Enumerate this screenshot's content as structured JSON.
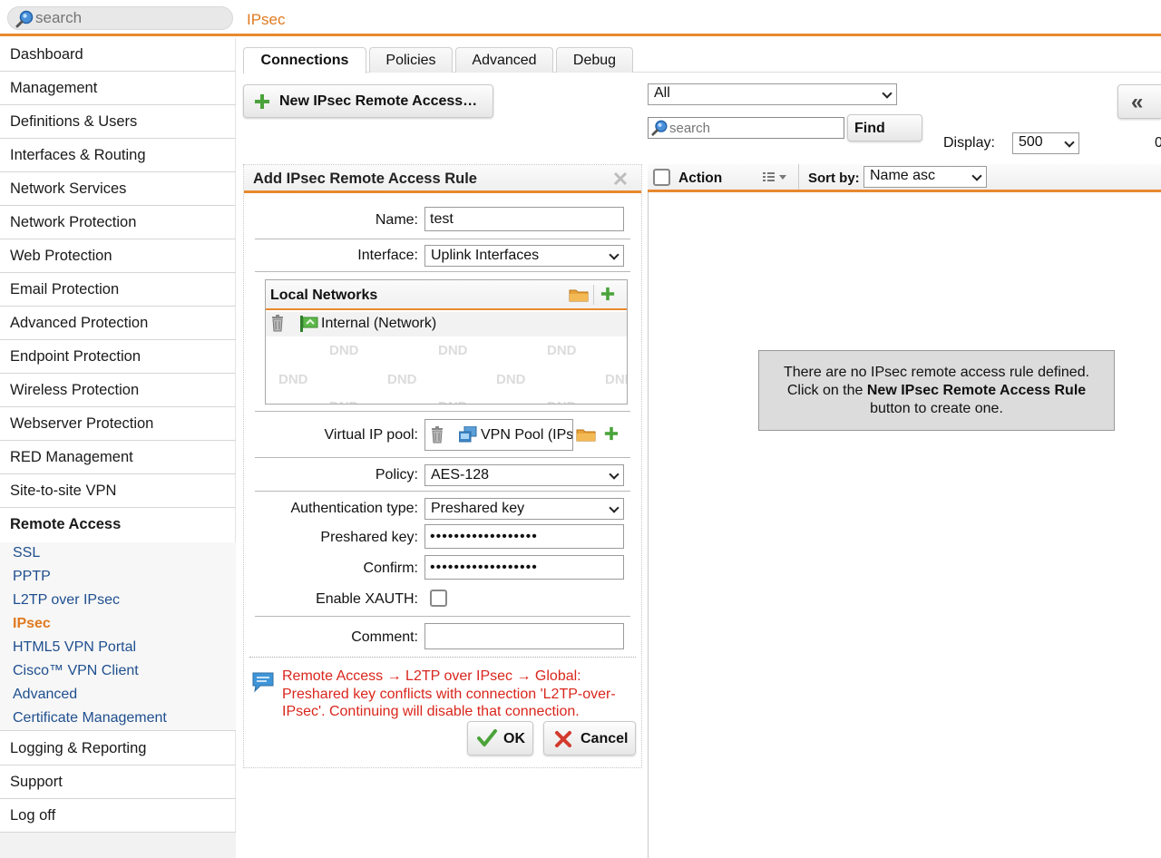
{
  "search": {
    "placeholder": "search"
  },
  "page_title": "IPsec",
  "sidebar": {
    "items": [
      {
        "label": "Dashboard"
      },
      {
        "label": "Management"
      },
      {
        "label": "Definitions & Users"
      },
      {
        "label": "Interfaces & Routing"
      },
      {
        "label": "Network Services"
      },
      {
        "label": "Network Protection"
      },
      {
        "label": "Web Protection"
      },
      {
        "label": "Email Protection"
      },
      {
        "label": "Advanced Protection"
      },
      {
        "label": "Endpoint Protection"
      },
      {
        "label": "Wireless Protection"
      },
      {
        "label": "Webserver Protection"
      },
      {
        "label": "RED Management"
      },
      {
        "label": "Site-to-site VPN"
      },
      {
        "label": "Remote Access"
      }
    ],
    "sub_items": [
      {
        "label": "SSL"
      },
      {
        "label": "PPTP"
      },
      {
        "label": "L2TP over IPsec"
      },
      {
        "label": "IPsec"
      },
      {
        "label": "HTML5 VPN Portal"
      },
      {
        "label": "Cisco™ VPN Client"
      },
      {
        "label": "Advanced"
      },
      {
        "label": "Certificate Management"
      }
    ],
    "bottom_items": [
      {
        "label": "Logging & Reporting"
      },
      {
        "label": "Support"
      },
      {
        "label": "Log off"
      }
    ]
  },
  "tabs": [
    {
      "label": "Connections"
    },
    {
      "label": "Policies"
    },
    {
      "label": "Advanced"
    },
    {
      "label": "Debug"
    }
  ],
  "new_button_label": "New IPsec Remote Access…",
  "filter": {
    "selected": "All",
    "search_placeholder": "search",
    "find_label": "Find",
    "display_label": "Display:",
    "display_value": "500",
    "count_partial": "0"
  },
  "list_header": {
    "action_label": "Action",
    "sort_label": "Sort by:",
    "sort_value": "Name asc"
  },
  "empty_message": {
    "line1": "There are no IPsec remote access rule defined.",
    "line2_prefix": "Click on the ",
    "line2_bold": "New IPsec Remote Access Rule",
    "line3": "button to create one."
  },
  "dialog": {
    "title": "Add IPsec Remote Access Rule",
    "name_label": "Name:",
    "name_value": "test",
    "interface_label": "Interface:",
    "interface_value": "Uplink Interfaces",
    "local_networks_title": "Local Networks",
    "local_network_entry": "Internal (Network)",
    "dnd_label": "DND",
    "virtual_ip_label": "Virtual IP pool:",
    "virtual_ip_value": "VPN Pool (IPsec)",
    "policy_label": "Policy:",
    "policy_value": "AES-128",
    "auth_type_label": "Authentication type:",
    "auth_type_value": "Preshared key",
    "psk_label": "Preshared key:",
    "psk_value": "••••••••••••••••••",
    "confirm_label": "Confirm:",
    "confirm_value": "••••••••••••••••••",
    "xauth_label": "Enable XAUTH:",
    "xauth_checked": false,
    "comment_label": "Comment:",
    "comment_value": "",
    "warning_line1": "Remote Access → L2TP over IPsec → Global:",
    "warning_line2": "Preshared key conflicts with connection 'L2TP-over-",
    "warning_line3": "IPsec'. Continuing will disable that connection.",
    "ok_label": "OK",
    "cancel_label": "Cancel"
  },
  "colors": {
    "accent": "#e8892e",
    "link": "#1f4f8f",
    "warning": "#d9261c",
    "add_green": "#4aa33a"
  }
}
